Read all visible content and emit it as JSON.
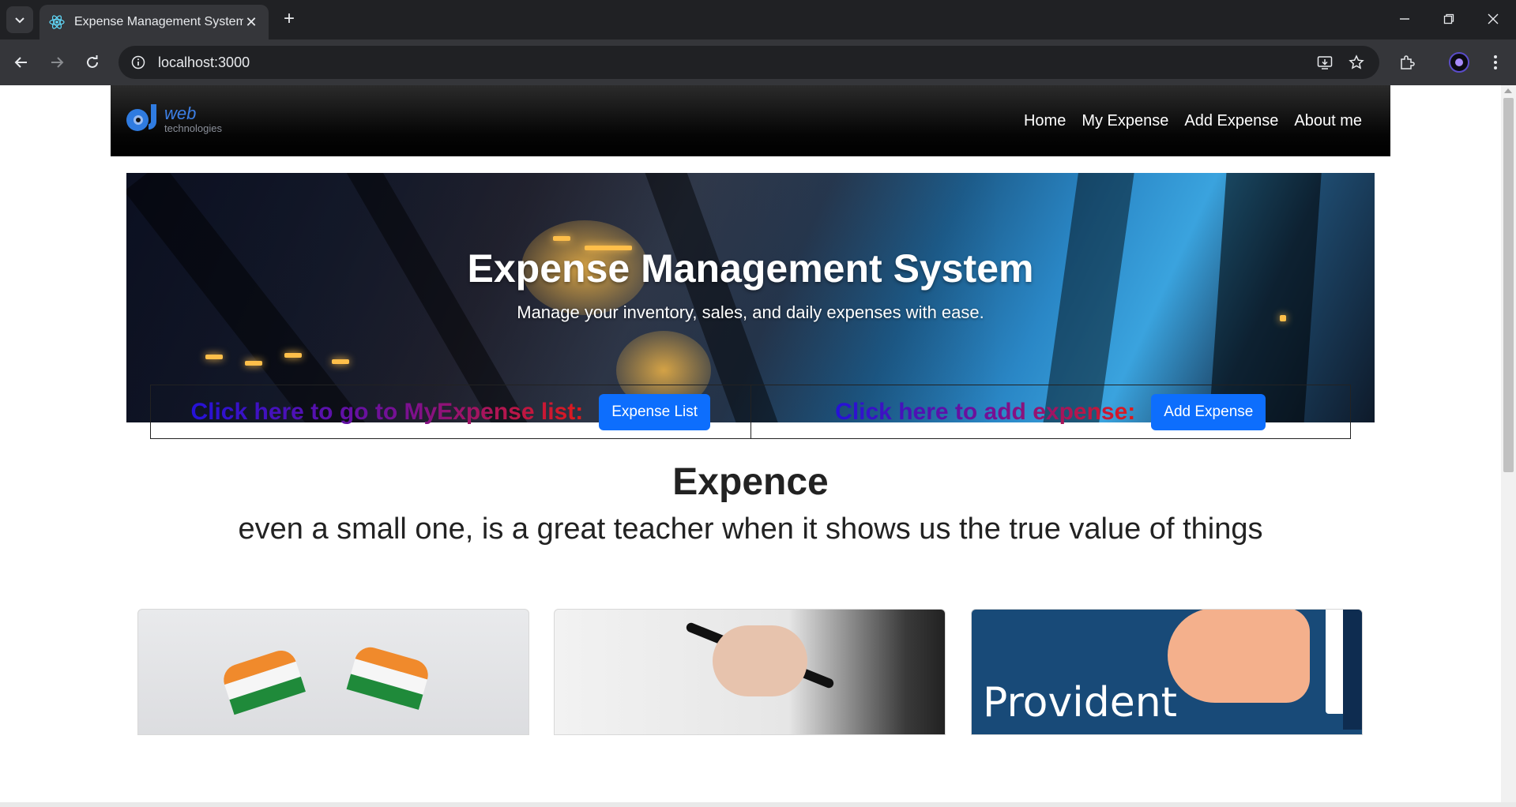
{
  "browser": {
    "tab_title": "Expense Management System",
    "url": "localhost:3000"
  },
  "nav": {
    "logo_primary": "web",
    "logo_secondary": "technologies",
    "links": [
      "Home",
      "My Expense",
      "Add Expense",
      "About me"
    ]
  },
  "hero": {
    "title": "Expense Management System",
    "subtitle": "Manage your inventory, sales, and daily expenses with ease."
  },
  "cta": {
    "left_text": "Click here to go to MyExpense list:",
    "left_button": "Expense List",
    "right_text": "Click here to add expense:",
    "right_button": "Add Expense"
  },
  "quote": {
    "title": "Expence",
    "text": "even a small one, is a great teacher when it shows us the true value of things"
  },
  "cards": {
    "card3_text": "Provident"
  },
  "colors": {
    "button": "#0d6efd",
    "gradient_start": "#2412d8",
    "gradient_end": "#e01a1a"
  }
}
